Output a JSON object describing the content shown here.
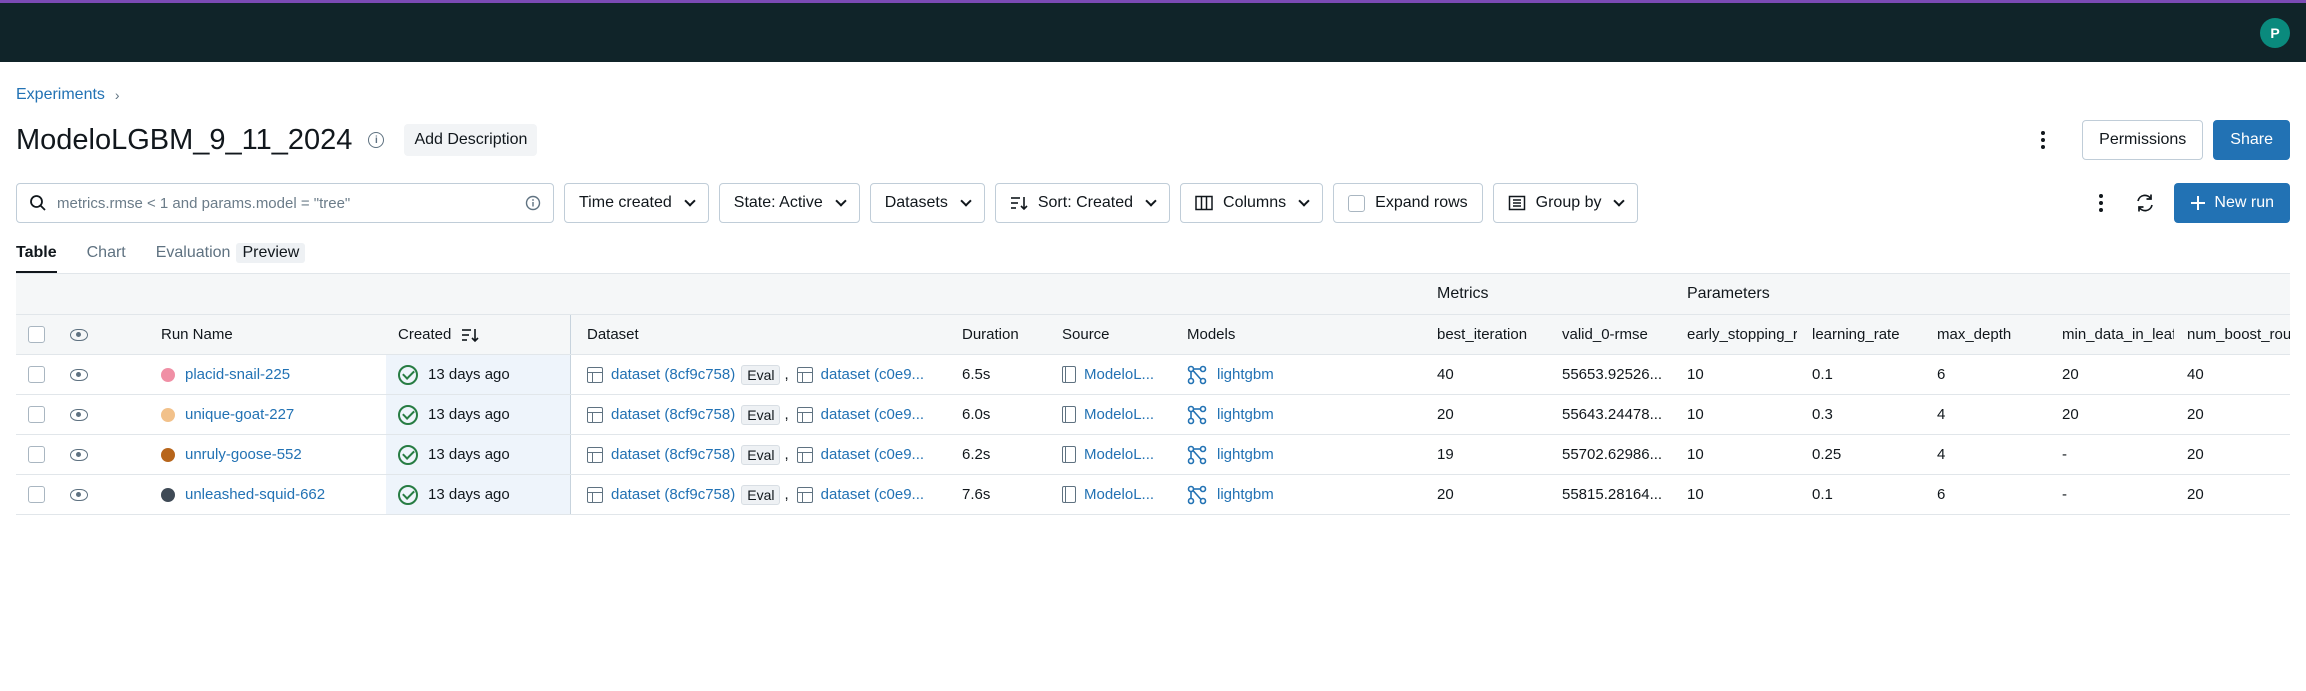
{
  "app": {
    "user_initial": "P"
  },
  "breadcrumb": {
    "experiments": "Experiments"
  },
  "header": {
    "title": "ModeloLGBM_9_11_2024",
    "add_description": "Add Description",
    "permissions": "Permissions",
    "share": "Share"
  },
  "toolbar": {
    "search_placeholder": "metrics.rmse < 1 and params.model = \"tree\"",
    "time_created": "Time created",
    "state": "State: Active",
    "datasets": "Datasets",
    "sort": "Sort: Created",
    "columns": "Columns",
    "expand_rows": "Expand rows",
    "group_by": "Group by",
    "new_run": "New run"
  },
  "tabs": {
    "table": "Table",
    "chart": "Chart",
    "evaluation": "Evaluation",
    "preview": "Preview"
  },
  "table": {
    "groups": {
      "metrics": "Metrics",
      "parameters": "Parameters"
    },
    "columns": {
      "run_name": "Run Name",
      "created": "Created",
      "dataset": "Dataset",
      "duration": "Duration",
      "source": "Source",
      "models": "Models",
      "best_iteration": "best_iteration",
      "valid_rmse": "valid_0-rmse",
      "early_stopping": "early_stopping_r",
      "learning_rate": "learning_rate",
      "max_depth": "max_depth",
      "min_data_in_leaf": "min_data_in_leaf",
      "num_boost_round": "num_boost_rou"
    },
    "rows": [
      {
        "color": "#f08fa5",
        "name": "placid-snail-225",
        "created": "13 days ago",
        "dataset1": "dataset (8cf9c758)",
        "eval": "Eval",
        "dataset2": "dataset (c0e9...",
        "duration": "6.5s",
        "source": "ModeloL...",
        "model": "lightgbm",
        "best_iteration": "40",
        "valid_rmse": "55653.92526...",
        "early_stopping": "10",
        "learning_rate": "0.1",
        "max_depth": "6",
        "min_data_in_leaf": "20",
        "num_boost_round": "40"
      },
      {
        "color": "#f2c18a",
        "name": "unique-goat-227",
        "created": "13 days ago",
        "dataset1": "dataset (8cf9c758)",
        "eval": "Eval",
        "dataset2": "dataset (c0e9...",
        "duration": "6.0s",
        "source": "ModeloL...",
        "model": "lightgbm",
        "best_iteration": "20",
        "valid_rmse": "55643.24478...",
        "early_stopping": "10",
        "learning_rate": "0.3",
        "max_depth": "4",
        "min_data_in_leaf": "20",
        "num_boost_round": "20"
      },
      {
        "color": "#b7651b",
        "name": "unruly-goose-552",
        "created": "13 days ago",
        "dataset1": "dataset (8cf9c758)",
        "eval": "Eval",
        "dataset2": "dataset (c0e9...",
        "duration": "6.2s",
        "source": "ModeloL...",
        "model": "lightgbm",
        "best_iteration": "19",
        "valid_rmse": "55702.62986...",
        "early_stopping": "10",
        "learning_rate": "0.25",
        "max_depth": "4",
        "min_data_in_leaf": "-",
        "num_boost_round": "20"
      },
      {
        "color": "#3f4a56",
        "name": "unleashed-squid-662",
        "created": "13 days ago",
        "dataset1": "dataset (8cf9c758)",
        "eval": "Eval",
        "dataset2": "dataset (c0e9...",
        "duration": "7.6s",
        "source": "ModeloL...",
        "model": "lightgbm",
        "best_iteration": "20",
        "valid_rmse": "55815.28164...",
        "early_stopping": "10",
        "learning_rate": "0.1",
        "max_depth": "6",
        "min_data_in_leaf": "-",
        "num_boost_round": "20"
      }
    ]
  }
}
